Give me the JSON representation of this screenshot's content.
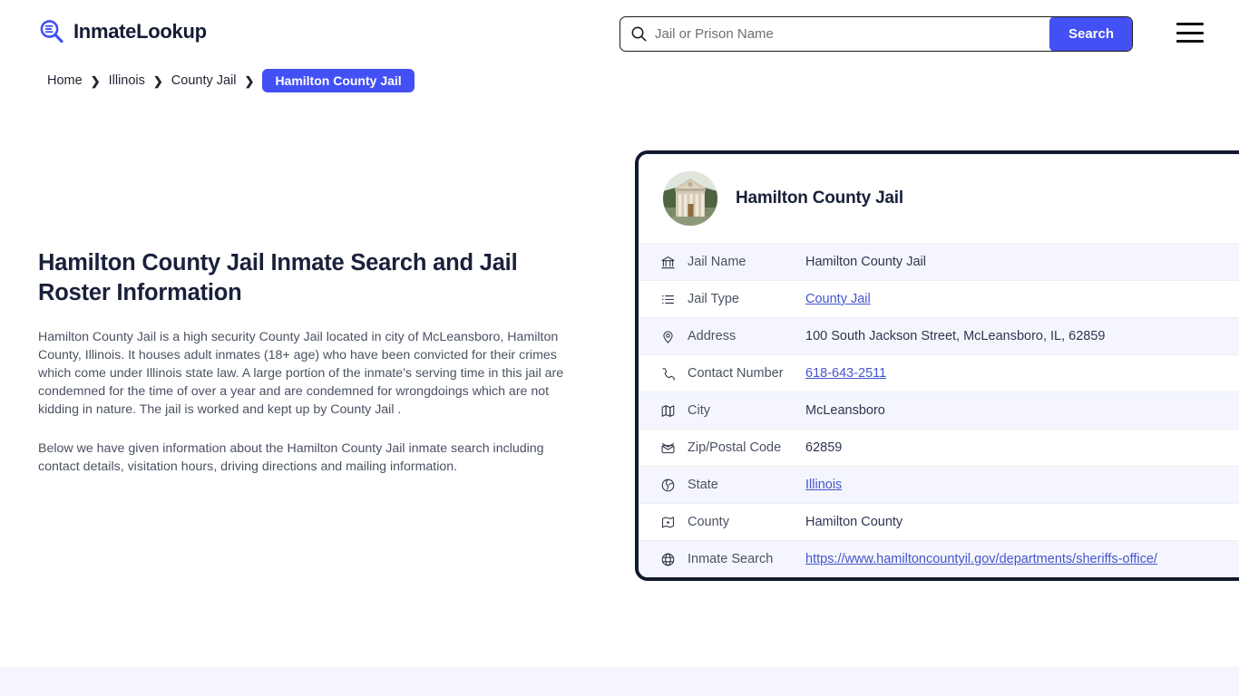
{
  "header": {
    "logo_text": "InmateLookup",
    "logo_icon": "magnifier-logo-icon",
    "search": {
      "placeholder": "Jail or Prison Name",
      "value": "",
      "icon": "search-icon",
      "button_label": "Search"
    },
    "menu_icon": "hamburger-menu-icon"
  },
  "breadcrumb": {
    "items": [
      {
        "label": "Home",
        "current": false
      },
      {
        "label": "Illinois",
        "current": false
      },
      {
        "label": "County Jail",
        "current": false
      },
      {
        "label": "Hamilton County Jail",
        "current": true
      }
    ],
    "separator": "❯"
  },
  "main": {
    "title": "Hamilton County Jail Inmate Search and Jail Roster Information",
    "paragraphs": [
      "Hamilton County Jail is a high security County Jail located in city of McLeansboro, Hamilton County, Illinois. It houses adult inmates (18+ age) who have been convicted for their crimes which come under Illinois state law. A large portion of the inmate's serving time in this jail are condemned for the time of over a year and are condemned for wrongdoings which are not kidding in nature. The jail is worked and kept up by County Jail .",
      "Below we have given information about the Hamilton County Jail inmate search including contact details, visitation hours, driving directions and mailing information."
    ]
  },
  "card": {
    "photo_alt": "hamilton-county-courthouse-photo",
    "title": "Hamilton County Jail",
    "rows": [
      {
        "icon": "bank-icon",
        "label": "Jail Name",
        "value": "Hamilton County Jail",
        "link": false
      },
      {
        "icon": "list-icon",
        "label": "Jail Type",
        "value": "County Jail",
        "link": true
      },
      {
        "icon": "location-pin-icon",
        "label": "Address",
        "value": "100 South Jackson Street, McLeansboro, IL, 62859",
        "link": false
      },
      {
        "icon": "phone-icon",
        "label": "Contact Number",
        "value": "618-643-2511",
        "link": true
      },
      {
        "icon": "map-icon",
        "label": "City",
        "value": "McLeansboro",
        "link": false
      },
      {
        "icon": "envelope-icon",
        "label": "Zip/Postal Code",
        "value": "62859",
        "link": false
      },
      {
        "icon": "globe-state-icon",
        "label": "State",
        "value": "Illinois",
        "link": true
      },
      {
        "icon": "county-map-icon",
        "label": "County",
        "value": "Hamilton County",
        "link": false
      },
      {
        "icon": "globe-icon",
        "label": "Inmate Search",
        "value": "https://www.hamiltoncountyil.gov/departments/sheriffs-office/",
        "link": true
      }
    ]
  },
  "colors": {
    "accent": "#4250f5",
    "card_border": "#131a2e",
    "row_alt": "#f5f6fd",
    "link": "#4455cc",
    "heading": "#19203a",
    "body_text": "#4a5262"
  }
}
